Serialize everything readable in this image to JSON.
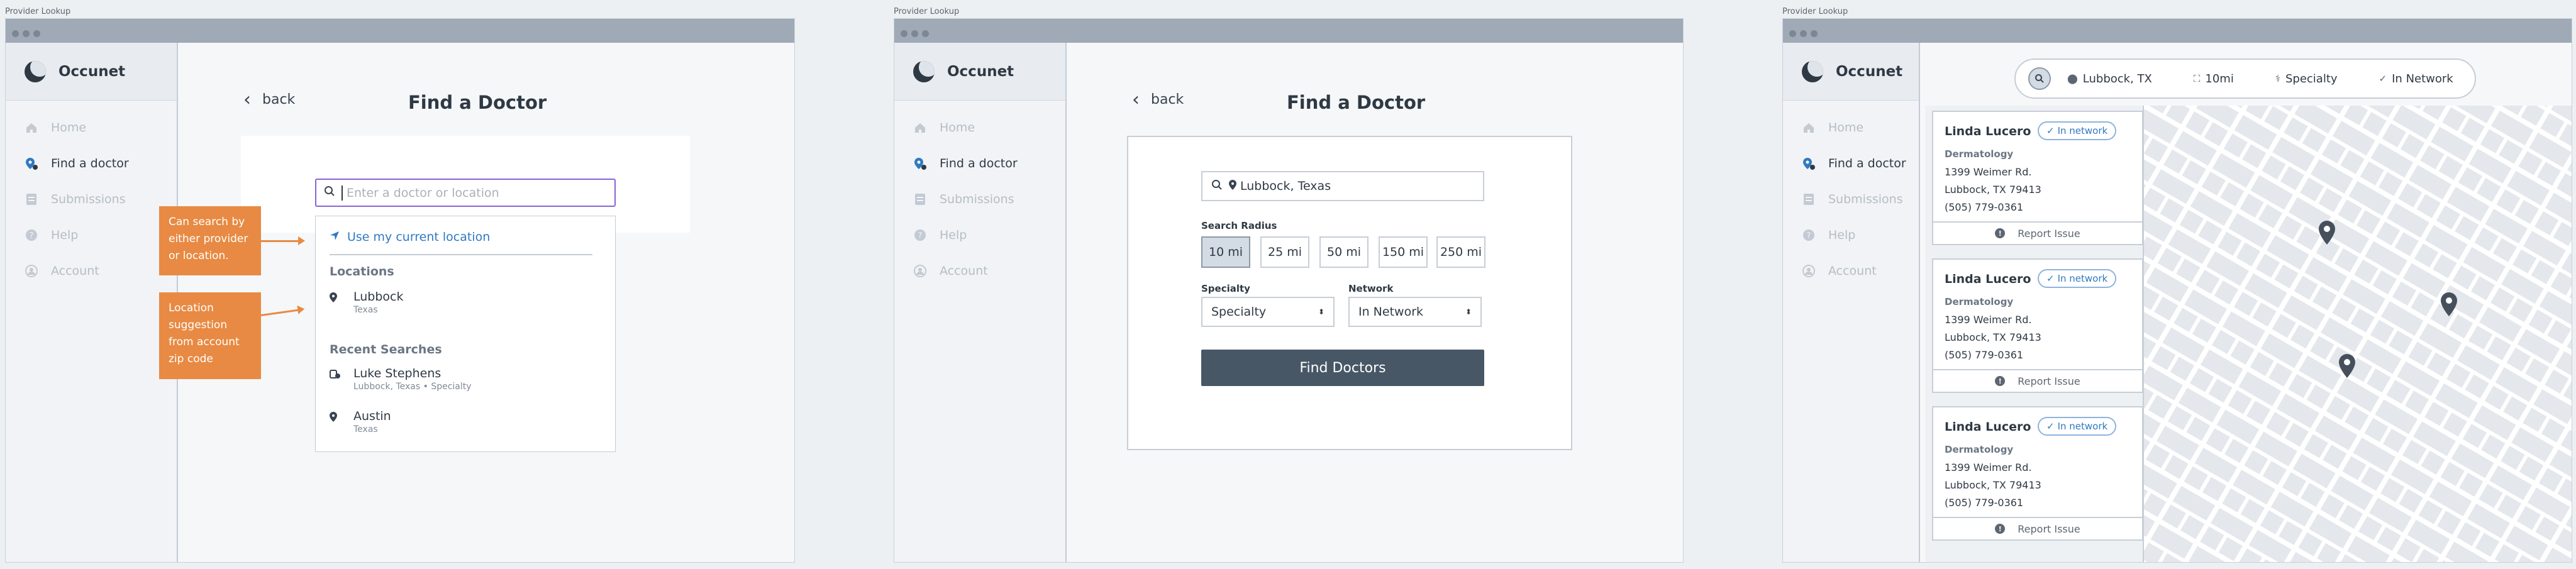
{
  "frames": [
    {
      "label": "Provider Lookup"
    },
    {
      "label": "Provider Lookup"
    },
    {
      "label": "Provider Lookup"
    }
  ],
  "app": {
    "brand": "Occunet"
  },
  "nav": [
    {
      "label": "Home",
      "icon": "home-icon"
    },
    {
      "label": "Find a doctor",
      "icon": "doctor-pin-icon"
    },
    {
      "label": "Submissions",
      "icon": "document-icon"
    },
    {
      "label": "Help",
      "icon": "help-icon"
    },
    {
      "label": "Account",
      "icon": "account-icon"
    }
  ],
  "page": {
    "title": "Find a Doctor",
    "back_label": "back"
  },
  "screen1": {
    "search_placeholder": "Enter a doctor or location",
    "use_location": "Use my current location",
    "locations_header": "Locations",
    "recent_header": "Recent Searches",
    "locations": [
      {
        "title": "Lubbock",
        "sub": "Texas"
      }
    ],
    "recent": [
      {
        "title": "Luke Stephens",
        "sub": "Lubbock, Texas • Specialty",
        "icon": "doctor-icon"
      },
      {
        "title": "Austin",
        "sub": "Texas",
        "icon": "pin-icon"
      }
    ],
    "notes": [
      "Can search by either provider or location.",
      "Location suggestion from account zip code"
    ]
  },
  "screen2": {
    "location_value": "Lubbock, Texas",
    "radius_label": "Search Radius",
    "radius_options": [
      "10 mi",
      "25 mi",
      "50 mi",
      "150 mi",
      "250 mi"
    ],
    "radius_selected": "10 mi",
    "specialty_label": "Specialty",
    "specialty_value": "Specialty",
    "network_label": "Network",
    "network_value": "In Network",
    "find_button": "Find Doctors"
  },
  "screen3": {
    "filters": {
      "location": "Lubbock, TX",
      "radius": "10mi",
      "specialty": "Specialty",
      "network": "In Network"
    },
    "results": [
      {
        "name": "Linda Lucero",
        "badge": "In network",
        "specialty": "Dermatology",
        "address1": "1399 Weimer Rd.",
        "address2": "Lubbock, TX 79413",
        "phone": "(505) 779-0361",
        "report": "Report Issue"
      },
      {
        "name": "Linda Lucero",
        "badge": "In network",
        "specialty": "Dermatology",
        "address1": "1399 Weimer Rd.",
        "address2": "Lubbock, TX 79413",
        "phone": "(505) 779-0361",
        "report": "Report Issue"
      },
      {
        "name": "Linda Lucero",
        "badge": "In network",
        "specialty": "Dermatology",
        "address1": "1399 Weimer Rd.",
        "address2": "Lubbock, TX 79413",
        "phone": "(505) 779-0361",
        "report": "Report Issue"
      }
    ],
    "map_pin_count": 3
  },
  "colors": {
    "accent": "#8b62d9",
    "link": "#2f79c2",
    "note": "#e88a43",
    "primary_button": "#485766"
  }
}
